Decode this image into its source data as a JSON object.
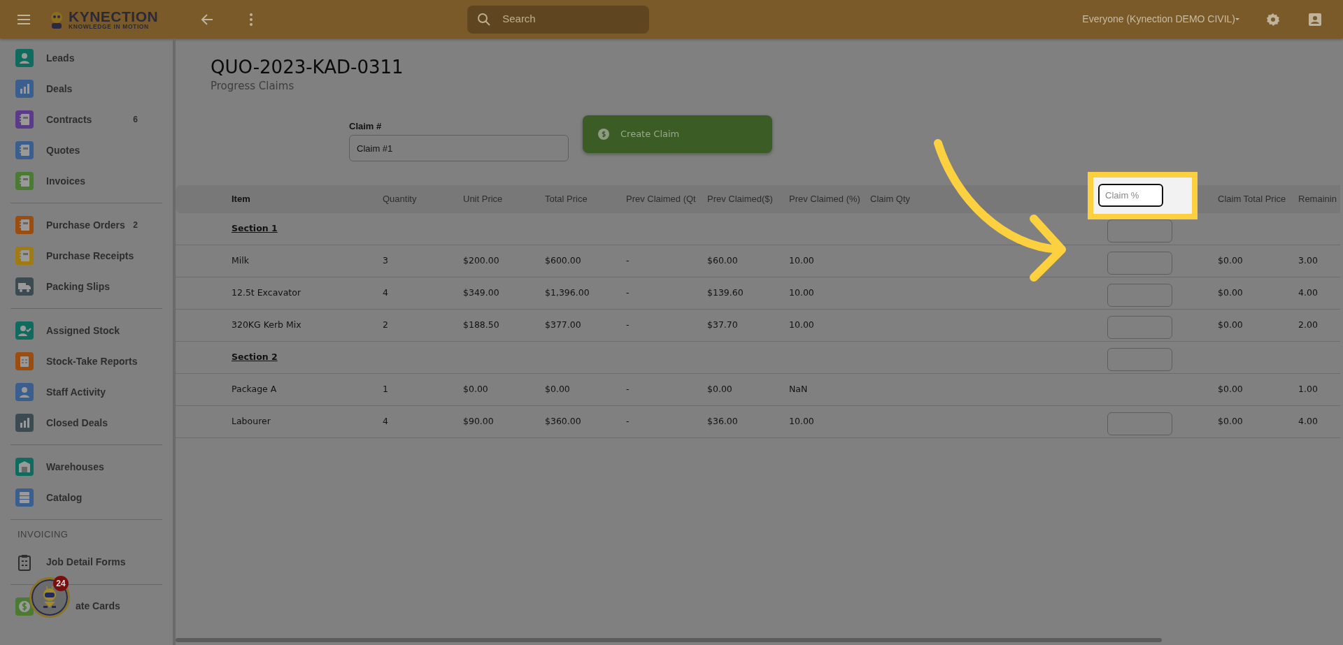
{
  "topbar": {
    "logo": {
      "name": "KYNECTION",
      "tagline": "KNOWLEDGE IN MOTION"
    },
    "search": {
      "placeholder": "Search"
    },
    "account": "Everyone (Kynection DEMO CIVIL)"
  },
  "sidebar": {
    "groups": [
      {
        "items": [
          {
            "label": "Leads",
            "kind": "person",
            "color": "#0e6b5e"
          },
          {
            "label": "Deals",
            "kind": "bars",
            "color": "#3a5f8f"
          },
          {
            "label": "Contracts",
            "kind": "notebook",
            "color": "#5b3a8a",
            "count": "6"
          },
          {
            "label": "Quotes",
            "kind": "notebook",
            "color": "#3a5f8f"
          },
          {
            "label": "Invoices",
            "kind": "notebook",
            "color": "#4b7a33"
          }
        ]
      },
      {
        "items": [
          {
            "label": "Purchase Orders",
            "kind": "notebook",
            "color": "#9b4d10",
            "count": "2"
          },
          {
            "label": "Purchase Receipts",
            "kind": "notebook",
            "color": "#a07a12"
          },
          {
            "label": "Packing Slips",
            "kind": "truck",
            "color": "#3c4a52"
          }
        ]
      },
      {
        "items": [
          {
            "label": "Assigned Stock",
            "kind": "personcheck",
            "color": "#0e6b5e"
          },
          {
            "label": "Stock-Take Reports",
            "kind": "clipboard",
            "color": "#9b4d10"
          },
          {
            "label": "Staff Activity",
            "kind": "person",
            "color": "#3a5f8f"
          },
          {
            "label": "Closed Deals",
            "kind": "bars",
            "color": "#3c4a52"
          }
        ]
      },
      {
        "items": [
          {
            "label": "Warehouses",
            "kind": "warehouse",
            "color": "#0e6b5e"
          },
          {
            "label": "Catalog",
            "kind": "catalog",
            "color": "#3a5f8f"
          }
        ]
      },
      {
        "label": "INVOICING",
        "items": [
          {
            "label": "Job Detail Forms",
            "kind": "form"
          }
        ]
      },
      {
        "items": [
          {
            "label": "ate Cards",
            "kind": "dollar",
            "color": "#4b7a33"
          }
        ]
      }
    ]
  },
  "page": {
    "title": "QUO-2023-KAD-0311",
    "subtitle": "Progress Claims"
  },
  "claim_form": {
    "label": "Claim #",
    "value": "Claim #1",
    "button": "Create Claim"
  },
  "table": {
    "columns": [
      {
        "kind": "text",
        "label": "Item"
      },
      {
        "kind": "text",
        "label": "Quantity"
      },
      {
        "kind": "text",
        "label": "Unit Price"
      },
      {
        "kind": "text",
        "label": "Total Price"
      },
      {
        "kind": "text",
        "label": "Prev Claimed (Qt"
      },
      {
        "kind": "text",
        "label": "Prev Claimed($)"
      },
      {
        "kind": "text",
        "label": "Prev Claimed (%)"
      },
      {
        "kind": "text",
        "label": "Claim Qty"
      },
      {
        "kind": "input",
        "placeholder": "Claim %",
        "focused": true,
        "highlighted": true
      },
      {
        "kind": "text",
        "label": "Claim Total Price"
      },
      {
        "kind": "text",
        "label": "Remainin"
      }
    ],
    "rows": [
      {
        "kind": "section",
        "label": "Section 1",
        "claim_input": true
      },
      {
        "kind": "item",
        "cells": [
          "Milk",
          "3",
          "$200.00",
          "$600.00",
          "-",
          "$60.00",
          "10.00"
        ],
        "claim_input": true,
        "claim_total": "$0.00",
        "remaining": "3.00"
      },
      {
        "kind": "item",
        "cells": [
          "12.5t Excavator",
          "4",
          "$349.00",
          "$1,396.00",
          "-",
          "$139.60",
          "10.00"
        ],
        "claim_input": true,
        "claim_total": "$0.00",
        "remaining": "4.00"
      },
      {
        "kind": "item",
        "cells": [
          "320KG Kerb Mix",
          "2",
          "$188.50",
          "$377.00",
          "-",
          "$37.70",
          "10.00"
        ],
        "claim_input": true,
        "claim_total": "$0.00",
        "remaining": "2.00"
      },
      {
        "kind": "section",
        "label": "Section 2",
        "claim_input": true
      },
      {
        "kind": "item",
        "cells": [
          "Package A",
          "1",
          "$0.00",
          "$0.00",
          "-",
          "$0.00",
          "NaN"
        ],
        "claim_input": false,
        "claim_total": "$0.00",
        "remaining": "1.00"
      },
      {
        "kind": "item",
        "cells": [
          "Labourer",
          "4",
          "$90.00",
          "$360.00",
          "-",
          "$36.00",
          "10.00"
        ],
        "claim_input": true,
        "claim_total": "$0.00",
        "remaining": "4.00"
      }
    ]
  },
  "assistant": {
    "badge": "24"
  }
}
